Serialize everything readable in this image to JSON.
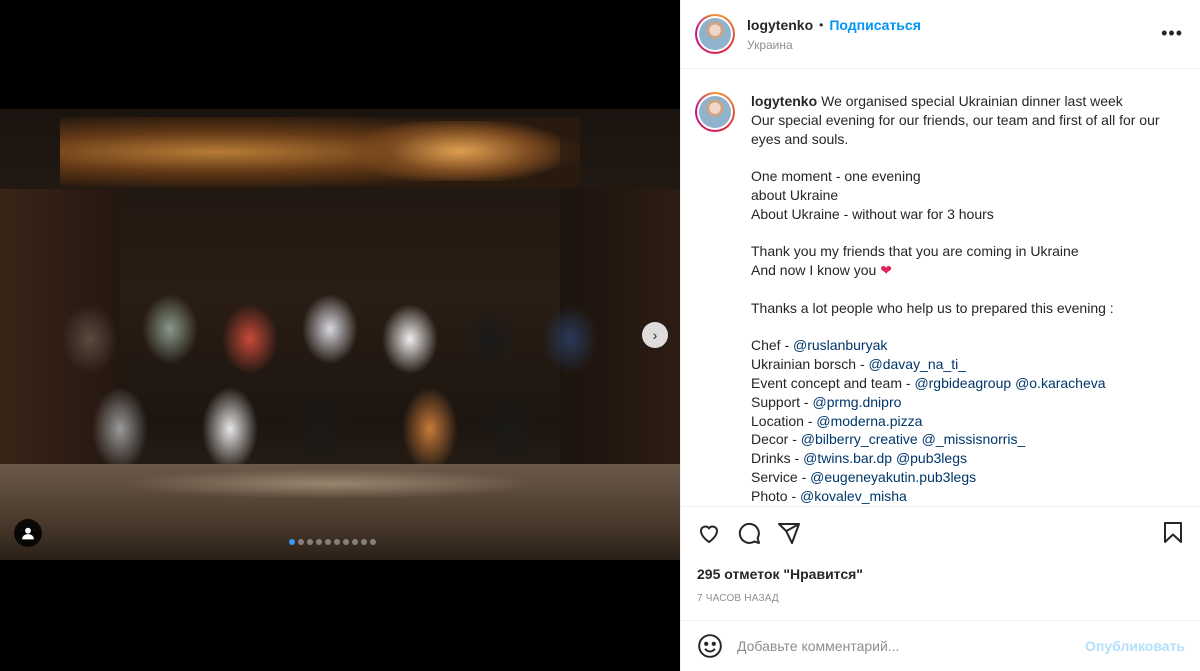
{
  "post": {
    "author": "logytenko",
    "separator": "•",
    "follow_label": "Подписаться",
    "location": "Украина",
    "more_label": "•••"
  },
  "carousel": {
    "next_label": "›",
    "total_slides": 10,
    "active_index": 0
  },
  "caption": {
    "lines": [
      [
        {
          "t": "We organised special Ukrainian dinner last week"
        }
      ],
      [
        {
          "t": "Our special evening for our friends, our team and first of all for our"
        }
      ],
      [
        {
          "t": "eyes and souls."
        }
      ],
      [
        {
          "t": ""
        }
      ],
      [
        {
          "t": "One moment - one evening"
        }
      ],
      [
        {
          "t": "about Ukraine"
        }
      ],
      [
        {
          "t": "About Ukraine - without war for 3 hours"
        }
      ],
      [
        {
          "t": ""
        }
      ],
      [
        {
          "t": "Thank you my friends that you are coming in Ukraine"
        }
      ],
      [
        {
          "t": "And now I know you "
        },
        {
          "t": "❤",
          "heart": true
        }
      ],
      [
        {
          "t": ""
        }
      ],
      [
        {
          "t": "Thanks a lot people who help us to prepared this evening :"
        }
      ],
      [
        {
          "t": ""
        }
      ],
      [
        {
          "t": "Chef - "
        },
        {
          "t": "@ruslanburyak",
          "m": true
        }
      ],
      [
        {
          "t": "Ukrainian borsch - "
        },
        {
          "t": "@davay_na_ti_",
          "m": true
        }
      ],
      [
        {
          "t": "Event concept and team - "
        },
        {
          "t": "@rgbideagroup",
          "m": true
        },
        {
          "t": " "
        },
        {
          "t": "@o.karacheva",
          "m": true
        }
      ],
      [
        {
          "t": "Support - "
        },
        {
          "t": "@prmg.dnipro",
          "m": true
        }
      ],
      [
        {
          "t": "Location - "
        },
        {
          "t": "@moderna.pizza",
          "m": true
        }
      ],
      [
        {
          "t": "Decor - "
        },
        {
          "t": "@bilberry_creative",
          "m": true
        },
        {
          "t": " "
        },
        {
          "t": "@_missisnorris_",
          "m": true
        }
      ],
      [
        {
          "t": "Drinks - "
        },
        {
          "t": "@twins.bar.dp",
          "m": true
        },
        {
          "t": " "
        },
        {
          "t": "@pub3legs",
          "m": true
        }
      ],
      [
        {
          "t": "Service - "
        },
        {
          "t": "@eugeneyakutin.pub3legs",
          "m": true
        }
      ],
      [
        {
          "t": "Photo - "
        },
        {
          "t": "@kovalev_misha",
          "m": true
        }
      ]
    ]
  },
  "stats": {
    "likes": "295 отметок \"Нравится\"",
    "time": "7 часов назад"
  },
  "comment": {
    "placeholder": "Добавьте комментарий...",
    "publish_label": "Опубликовать"
  },
  "colors": {
    "accent": "#0095f6",
    "mention": "#00376b",
    "publish_disabled": "#b2dffc",
    "heart": "#e0245e"
  }
}
